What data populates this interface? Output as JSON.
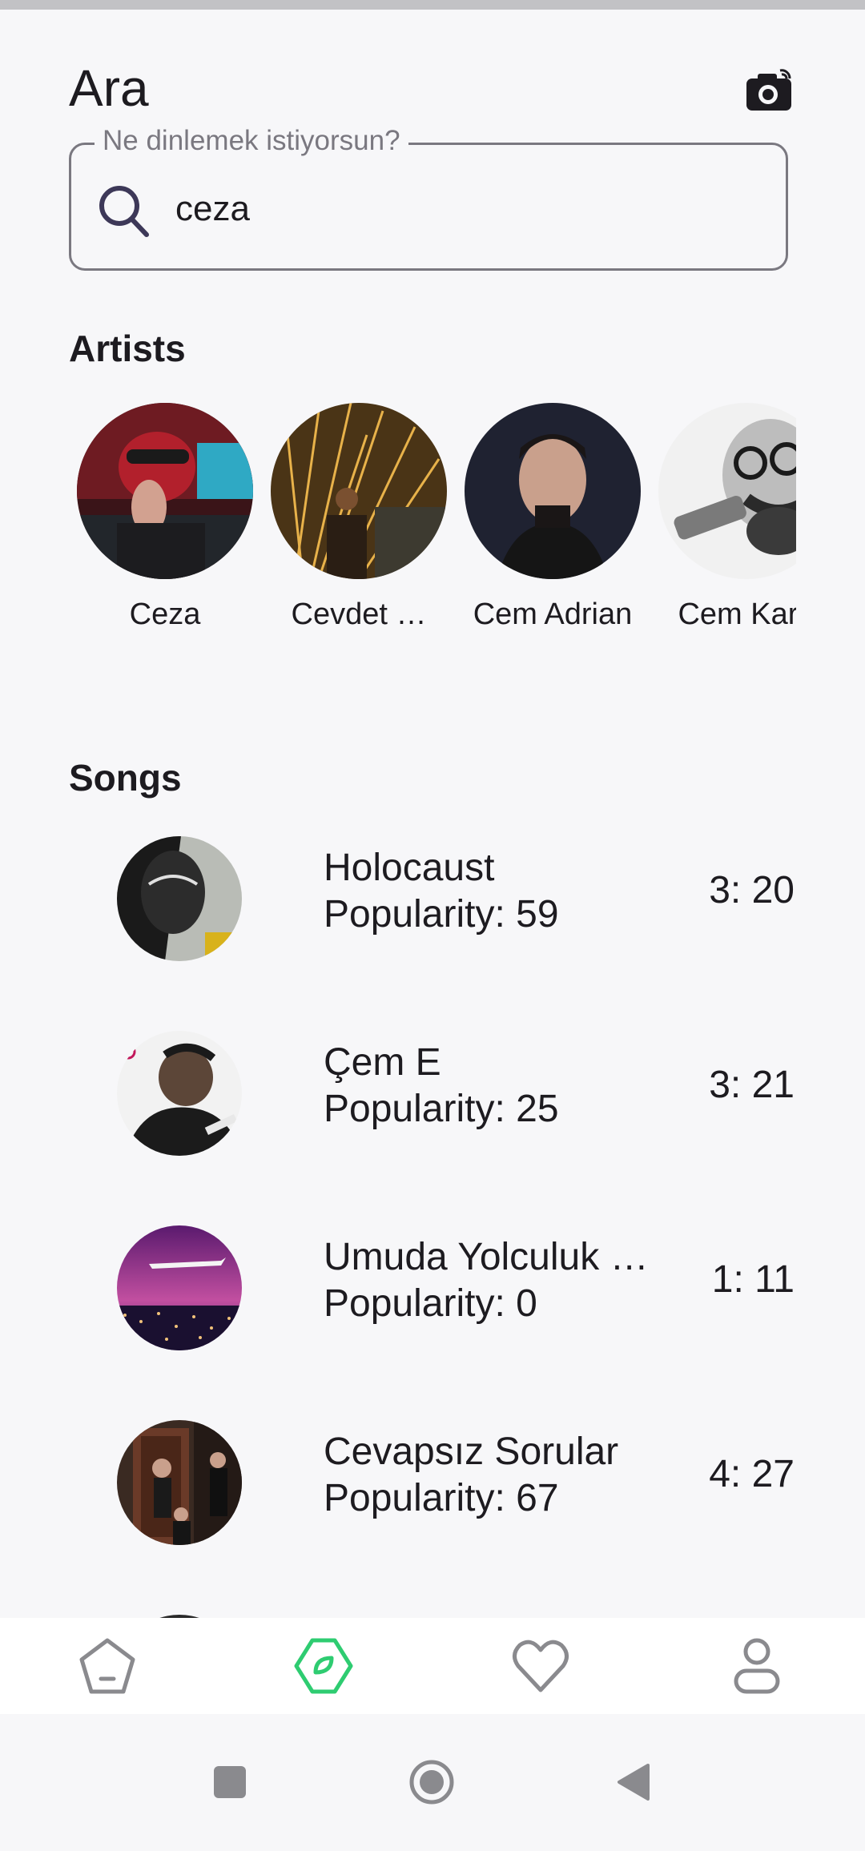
{
  "page": {
    "title": "Ara"
  },
  "search": {
    "label": "Ne dinlemek istiyorsun?",
    "value": "ceza"
  },
  "artists_section": {
    "heading": "Artists",
    "items": [
      {
        "name": "Ceza"
      },
      {
        "name": "Cevdet …"
      },
      {
        "name": "Cem Adrian"
      },
      {
        "name": "Cem Kara"
      }
    ]
  },
  "songs_section": {
    "heading": "Songs",
    "items": [
      {
        "title": "Holocaust",
        "popularity": "Popularity: 59",
        "duration": "3: 20"
      },
      {
        "title": "Çem E",
        "popularity": "Popularity: 25",
        "duration": "3: 21"
      },
      {
        "title": "Umuda Yolculuk …",
        "popularity": "Popularity: 0",
        "duration": "1: 11"
      },
      {
        "title": "Cevapsız Sorular",
        "popularity": "Popularity: 67",
        "duration": "4: 27"
      }
    ]
  },
  "bottom_nav": {
    "items": [
      {
        "icon": "home-icon",
        "active": false
      },
      {
        "icon": "explore-icon",
        "active": true
      },
      {
        "icon": "heart-icon",
        "active": false
      },
      {
        "icon": "profile-icon",
        "active": false
      }
    ],
    "active_color": "#2ecc71",
    "inactive_color": "#8a8a8e"
  },
  "system_nav": {
    "buttons": [
      "recents-icon",
      "home-circle-icon",
      "back-icon"
    ]
  }
}
